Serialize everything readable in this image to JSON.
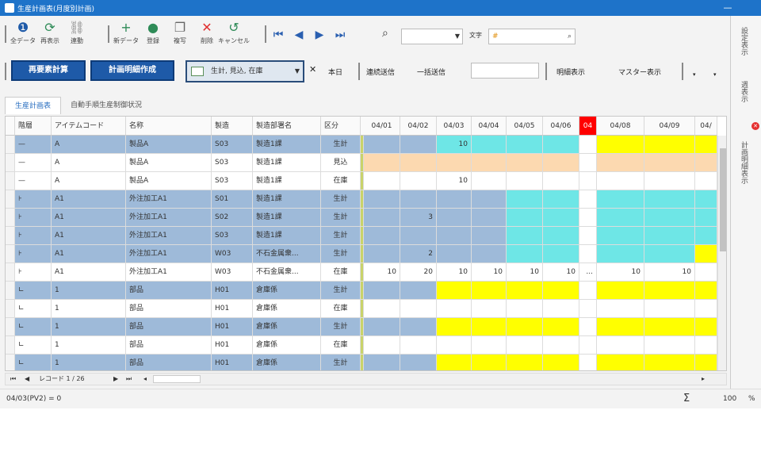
{
  "window": {
    "title": "生産計画表(月度別計画)"
  },
  "toolbar": {
    "buttons": [
      {
        "label": "全データ",
        "icon": "info-icon",
        "color": "#1e5aa8"
      },
      {
        "label": "再表示",
        "icon": "refresh-icon",
        "color": "#2e8b57"
      },
      {
        "label": "連動",
        "icon": "link-icon",
        "color": "#888888"
      },
      {
        "label": "新データ",
        "icon": "plus-icon",
        "color": "#2e8b57"
      },
      {
        "label": "登録",
        "icon": "check-icon",
        "color": "#2e8b57"
      },
      {
        "label": "複写",
        "icon": "copy-icon",
        "color": "#666666"
      },
      {
        "label": "削除",
        "icon": "delete-icon",
        "color": "#e03030"
      },
      {
        "label": "キャンセル",
        "icon": "undo-icon",
        "color": "#2e8b57"
      }
    ],
    "search_prefix": "文字",
    "search_value": "#"
  },
  "toolbar2": {
    "recalc_button": "再要素計算",
    "create_plan_button": "計画明細作成",
    "filter_combo": "生計, 見込, 在庫",
    "today_label": "本日",
    "continuous_send_label": "連続送信",
    "bulk_send_label": "一括送信",
    "detail_view_label": "明細表示",
    "master_view_label": "マスター表示"
  },
  "tabs": [
    {
      "label": "生産計画表",
      "active": true
    },
    {
      "label": "自動手順生産制御状況",
      "active": false
    }
  ],
  "columns": [
    "階層",
    "アイテムコード",
    "名称",
    "製造",
    "製造部署名",
    "区分"
  ],
  "dates": [
    "04/01",
    "04/02",
    "04/03",
    "04/04",
    "04/05",
    "04/06",
    "04",
    "04/08",
    "04/09",
    "04/"
  ],
  "rows": [
    {
      "level": "—",
      "item": "A",
      "name": "製品A",
      "code": "S03",
      "dept": "製造1課",
      "type": "生計",
      "cells": [
        "",
        "",
        "10",
        "",
        "",
        "",
        "",
        "",
        "",
        ""
      ],
      "colors": [
        "#9ebad9",
        "#9ebad9",
        "#6ee6e6",
        "#6ee6e6",
        "#6ee6e6",
        "#6ee6e6",
        "#ffffff",
        "#ffff00",
        "#ffff00",
        "#ffff00"
      ],
      "row_bg": "#9ebad9"
    },
    {
      "level": "—",
      "item": "A",
      "name": "製品A",
      "code": "S03",
      "dept": "製造1課",
      "type": "見込",
      "cells": [
        "",
        "",
        "",
        "",
        "",
        "",
        "",
        "",
        "",
        ""
      ],
      "colors": [
        "#fcd9b0",
        "#fcd9b0",
        "#fcd9b0",
        "#fcd9b0",
        "#fcd9b0",
        "#fcd9b0",
        "#ffffff",
        "#fcd9b0",
        "#fcd9b0",
        "#fcd9b0"
      ],
      "row_bg": "#ffffff"
    },
    {
      "level": "—",
      "item": "A",
      "name": "製品A",
      "code": "S03",
      "dept": "製造1課",
      "type": "在庫",
      "cells": [
        "",
        "",
        "10",
        "",
        "",
        "",
        "",
        "",
        "",
        ""
      ],
      "colors": [
        "#ffffff",
        "#ffffff",
        "#ffffff",
        "#ffffff",
        "#ffffff",
        "#ffffff",
        "#ffffff",
        "#ffffff",
        "#ffffff",
        "#ffffff"
      ],
      "row_bg": "#ffffff"
    },
    {
      "level": "⊦",
      "item": "A1",
      "name": "外注加工A1",
      "code": "S01",
      "dept": "製造1課",
      "type": "生計",
      "cells": [
        "",
        "",
        "",
        "",
        "",
        "",
        "",
        "",
        "",
        ""
      ],
      "colors": [
        "#9ebad9",
        "#9ebad9",
        "#9ebad9",
        "#9ebad9",
        "#6ee6e6",
        "#6ee6e6",
        "#ffffff",
        "#6ee6e6",
        "#6ee6e6",
        "#6ee6e6"
      ],
      "row_bg": "#9ebad9"
    },
    {
      "level": "⊦",
      "item": "A1",
      "name": "外注加工A1",
      "code": "S02",
      "dept": "製造1課",
      "type": "生計",
      "cells": [
        "",
        "3",
        "",
        "",
        "",
        "",
        "",
        "",
        "",
        ""
      ],
      "colors": [
        "#9ebad9",
        "#9ebad9",
        "#9ebad9",
        "#9ebad9",
        "#6ee6e6",
        "#6ee6e6",
        "#ffffff",
        "#6ee6e6",
        "#6ee6e6",
        "#6ee6e6"
      ],
      "row_bg": "#9ebad9"
    },
    {
      "level": "⊦",
      "item": "A1",
      "name": "外注加工A1",
      "code": "S03",
      "dept": "製造1課",
      "type": "生計",
      "cells": [
        "",
        "",
        "",
        "",
        "",
        "",
        "",
        "",
        "",
        ""
      ],
      "colors": [
        "#9ebad9",
        "#9ebad9",
        "#9ebad9",
        "#9ebad9",
        "#6ee6e6",
        "#6ee6e6",
        "#ffffff",
        "#6ee6e6",
        "#6ee6e6",
        "#6ee6e6"
      ],
      "row_bg": "#9ebad9"
    },
    {
      "level": "⊦",
      "item": "A1",
      "name": "外注加工A1",
      "code": "W03",
      "dept": "不石金属衆...",
      "type": "生計",
      "cells": [
        "",
        "2",
        "",
        "",
        "",
        "",
        "",
        "",
        "",
        ""
      ],
      "colors": [
        "#9ebad9",
        "#9ebad9",
        "#9ebad9",
        "#9ebad9",
        "#6ee6e6",
        "#6ee6e6",
        "#ffffff",
        "#6ee6e6",
        "#6ee6e6",
        "#ffff00"
      ],
      "row_bg": "#9ebad9"
    },
    {
      "level": "⊦",
      "item": "A1",
      "name": "外注加工A1",
      "code": "W03",
      "dept": "不石金属衆...",
      "type": "在庫",
      "cells": [
        "10",
        "20",
        "10",
        "10",
        "10",
        "10",
        "...",
        "10",
        "10",
        ""
      ],
      "colors": [
        "#ffffff",
        "#ffffff",
        "#ffffff",
        "#ffffff",
        "#ffffff",
        "#ffffff",
        "#ffffff",
        "#ffffff",
        "#ffffff",
        "#ffffff"
      ],
      "row_bg": "#ffffff"
    },
    {
      "level": "∟",
      "item": "1",
      "name": "部品",
      "code": "H01",
      "dept": "倉庫係",
      "type": "生計",
      "cells": [
        "",
        "",
        "",
        "",
        "",
        "",
        "",
        "",
        "",
        ""
      ],
      "colors": [
        "#9ebad9",
        "#9ebad9",
        "#ffff00",
        "#ffff00",
        "#ffff00",
        "#ffff00",
        "#ffffff",
        "#ffff00",
        "#ffff00",
        "#ffff00"
      ],
      "row_bg": "#9ebad9"
    },
    {
      "level": "∟",
      "item": "1",
      "name": "部品",
      "code": "H01",
      "dept": "倉庫係",
      "type": "在庫",
      "cells": [
        "",
        "",
        "",
        "",
        "",
        "",
        "",
        "",
        "",
        ""
      ],
      "colors": [
        "#ffffff",
        "#ffffff",
        "#ffffff",
        "#ffffff",
        "#ffffff",
        "#ffffff",
        "#ffffff",
        "#ffffff",
        "#ffffff",
        "#ffffff"
      ],
      "row_bg": "#ffffff"
    },
    {
      "level": "∟",
      "item": "1",
      "name": "部品",
      "code": "H01",
      "dept": "倉庫係",
      "type": "生計",
      "cells": [
        "",
        "",
        "",
        "",
        "",
        "",
        "",
        "",
        "",
        ""
      ],
      "colors": [
        "#9ebad9",
        "#9ebad9",
        "#ffff00",
        "#ffff00",
        "#ffff00",
        "#ffff00",
        "#ffffff",
        "#ffff00",
        "#ffff00",
        "#ffff00"
      ],
      "row_bg": "#9ebad9"
    },
    {
      "level": "∟",
      "item": "1",
      "name": "部品",
      "code": "H01",
      "dept": "倉庫係",
      "type": "在庫",
      "cells": [
        "",
        "",
        "",
        "",
        "",
        "",
        "",
        "",
        "",
        ""
      ],
      "colors": [
        "#ffffff",
        "#ffffff",
        "#ffffff",
        "#ffffff",
        "#ffffff",
        "#ffffff",
        "#ffffff",
        "#ffffff",
        "#ffffff",
        "#ffffff"
      ],
      "row_bg": "#ffffff"
    },
    {
      "level": "∟",
      "item": "1",
      "name": "部品",
      "code": "H01",
      "dept": "倉庫係",
      "type": "生計",
      "cells": [
        "",
        "",
        "",
        "",
        "",
        "",
        "",
        "",
        "",
        ""
      ],
      "colors": [
        "#9ebad9",
        "#9ebad9",
        "#ffff00",
        "#ffff00",
        "#ffff00",
        "#ffff00",
        "#ffffff",
        "#ffff00",
        "#ffff00",
        "#ffff00"
      ],
      "row_bg": "#9ebad9"
    }
  ],
  "pager": {
    "text": "レコード 1 / 26"
  },
  "status": {
    "left": "04/03(PV2) = 0",
    "zoom": "100",
    "percent": "%"
  },
  "sidepanel": {
    "items": [
      "設定表示",
      "週表示",
      "計画明細表示"
    ]
  },
  "colors": {
    "accent": "#1e73c9",
    "today": "#ff0000"
  }
}
